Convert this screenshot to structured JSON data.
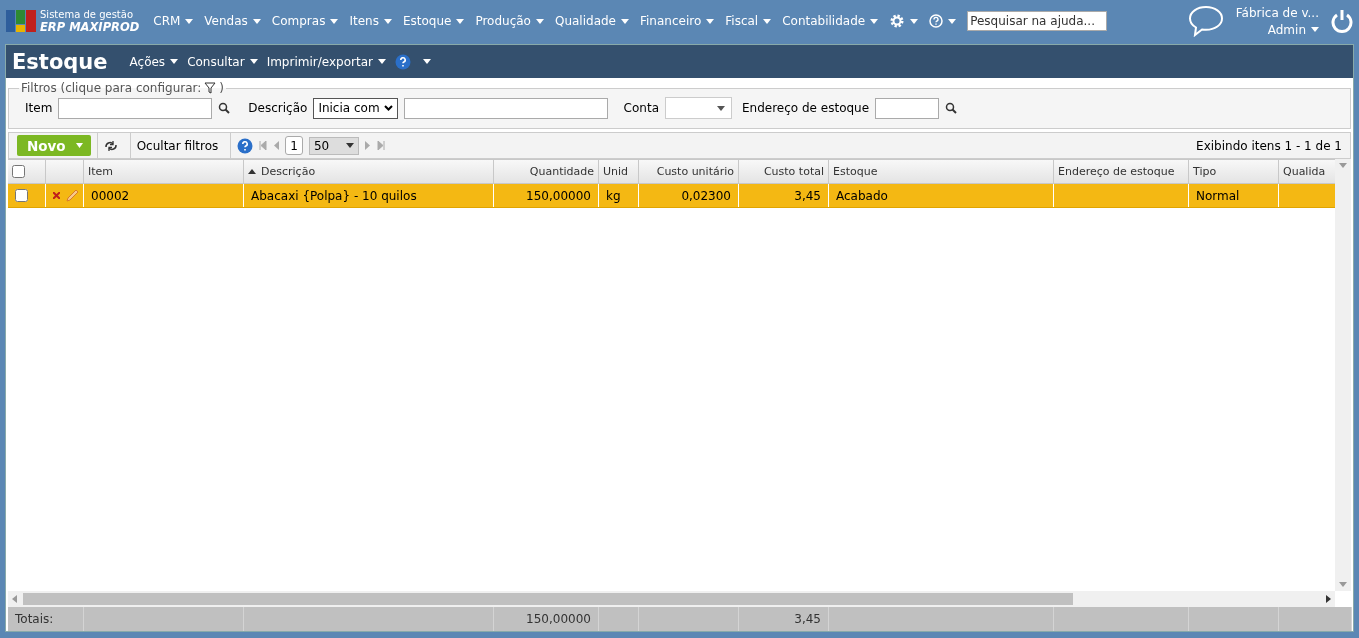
{
  "logo": {
    "line1": "Sistema de gestão",
    "line2": "ERP MAXIPROD"
  },
  "menu": [
    "CRM",
    "Vendas",
    "Compras",
    "Itens",
    "Estoque",
    "Produção",
    "Qualidade",
    "Financeiro",
    "Fiscal",
    "Contabilidade"
  ],
  "help_search": {
    "placeholder": "Pesquisar na ajuda..."
  },
  "user": {
    "company": "Fábrica de v...",
    "name": "Admin"
  },
  "page": {
    "title": "Estoque",
    "menu": [
      "Ações",
      "Consultar",
      "Imprimir/exportar"
    ]
  },
  "filters": {
    "legend": "Filtros (clique para configurar:",
    "legend_end": ")",
    "item_label": "Item",
    "description_label": "Descrição",
    "description_mode": "Inicia com",
    "account_label": "Conta",
    "address_label": "Endereço de estoque"
  },
  "toolbar": {
    "new_button": "Novo",
    "hide_filters": "Ocultar filtros",
    "page": "1",
    "page_size": "50",
    "summary": "Exibindo itens 1 - 1 de 1"
  },
  "table": {
    "all_checked": false,
    "columns": [
      {
        "kind": "check"
      },
      {
        "kind": "actions"
      },
      {
        "label": "Item",
        "kind": "text"
      },
      {
        "label": "Descrição",
        "kind": "text",
        "sorted": true
      },
      {
        "label": "Quantidade",
        "kind": "number",
        "total": "150,00000"
      },
      {
        "label": "Unid",
        "kind": "text"
      },
      {
        "label": "Custo unitário",
        "kind": "number"
      },
      {
        "label": "Custo total",
        "kind": "number",
        "total": "3,45"
      },
      {
        "label": "Estoque",
        "kind": "text"
      },
      {
        "label": "Endereço de estoque",
        "kind": "text"
      },
      {
        "label": "Tipo",
        "kind": "text"
      },
      {
        "label": "Qualida",
        "kind": "text"
      }
    ],
    "rows": [
      {
        "selected": true,
        "checked": false,
        "cells": [
          null,
          null,
          "00002",
          "Abacaxi {Polpa} - 10 quilos",
          "150,00000",
          "kg",
          "0,02300",
          "3,45",
          "Acabado",
          null,
          "Normal",
          null
        ]
      }
    ],
    "totals_label": "Totais:"
  }
}
